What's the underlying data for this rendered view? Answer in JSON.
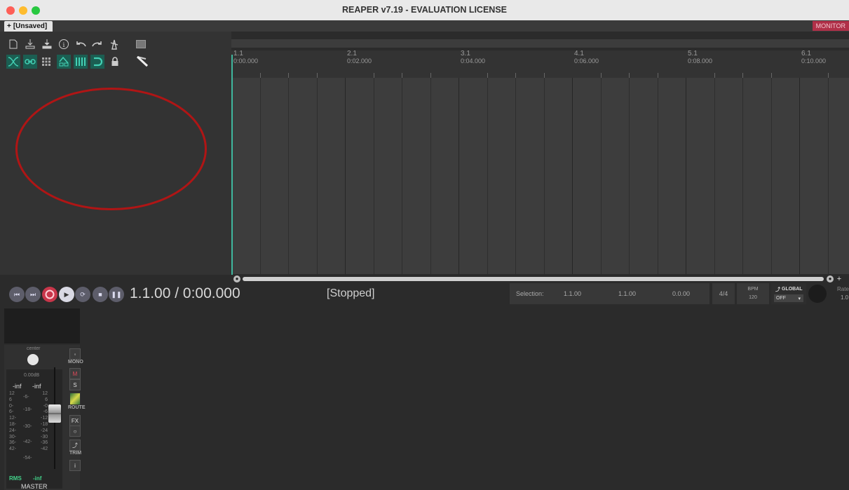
{
  "window": {
    "title": "REAPER v7.19 - EVALUATION LICENSE"
  },
  "tabs": [
    {
      "label": "[Unsaved]"
    }
  ],
  "monitor_label": "MONITOR",
  "timeline": {
    "markers": [
      {
        "bar": "1.1",
        "time": "0:00.000"
      },
      {
        "bar": "2.1",
        "time": "0:02.000"
      },
      {
        "bar": "3.1",
        "time": "0:04.000"
      },
      {
        "bar": "4.1",
        "time": "0:06.000"
      },
      {
        "bar": "5.1",
        "time": "0:08.000"
      },
      {
        "bar": "6.1",
        "time": "0:10.000"
      }
    ]
  },
  "transport": {
    "position": "1.1.00 / 0:00.000",
    "status": "[Stopped]",
    "selection_label": "Selection:",
    "selection_start": "1.1.00",
    "selection_end": "1.1.00",
    "selection_length": "0.0.00",
    "time_signature": "4/4",
    "bpm_label": "BPM",
    "bpm_value": "120",
    "global_label": "GLOBAL",
    "global_value": "OFF",
    "rate_label": "Rate",
    "rate_value": "1.0"
  },
  "master": {
    "pan_label": "center",
    "volume": "0.00dB",
    "peak_left": "-inf",
    "peak_right": "-inf",
    "scale_left": [
      "12",
      "6",
      "0-",
      "6-",
      "12-",
      "18-",
      "24-",
      "30-",
      "36-",
      "42-"
    ],
    "scale_mid": [
      "-6-",
      "-18-",
      "-30-",
      "-42-",
      "-54-"
    ],
    "scale_right": [
      "12",
      "6",
      "-0",
      "-6",
      "-12",
      "-18",
      "-24",
      "-30",
      "-36",
      "-42"
    ],
    "rms_label": "RMS",
    "rms_value": "-inf",
    "name": "MASTER",
    "buttons": {
      "mono": "MONO",
      "mute": "M",
      "solo": "S",
      "route": "ROUTE",
      "fx": "FX",
      "trim": "TRIM",
      "info": "i"
    }
  },
  "colors": {
    "accent": "#3fb79e",
    "record": "#c8364a",
    "monitor": "#b03048",
    "annotation": "#b01515"
  }
}
